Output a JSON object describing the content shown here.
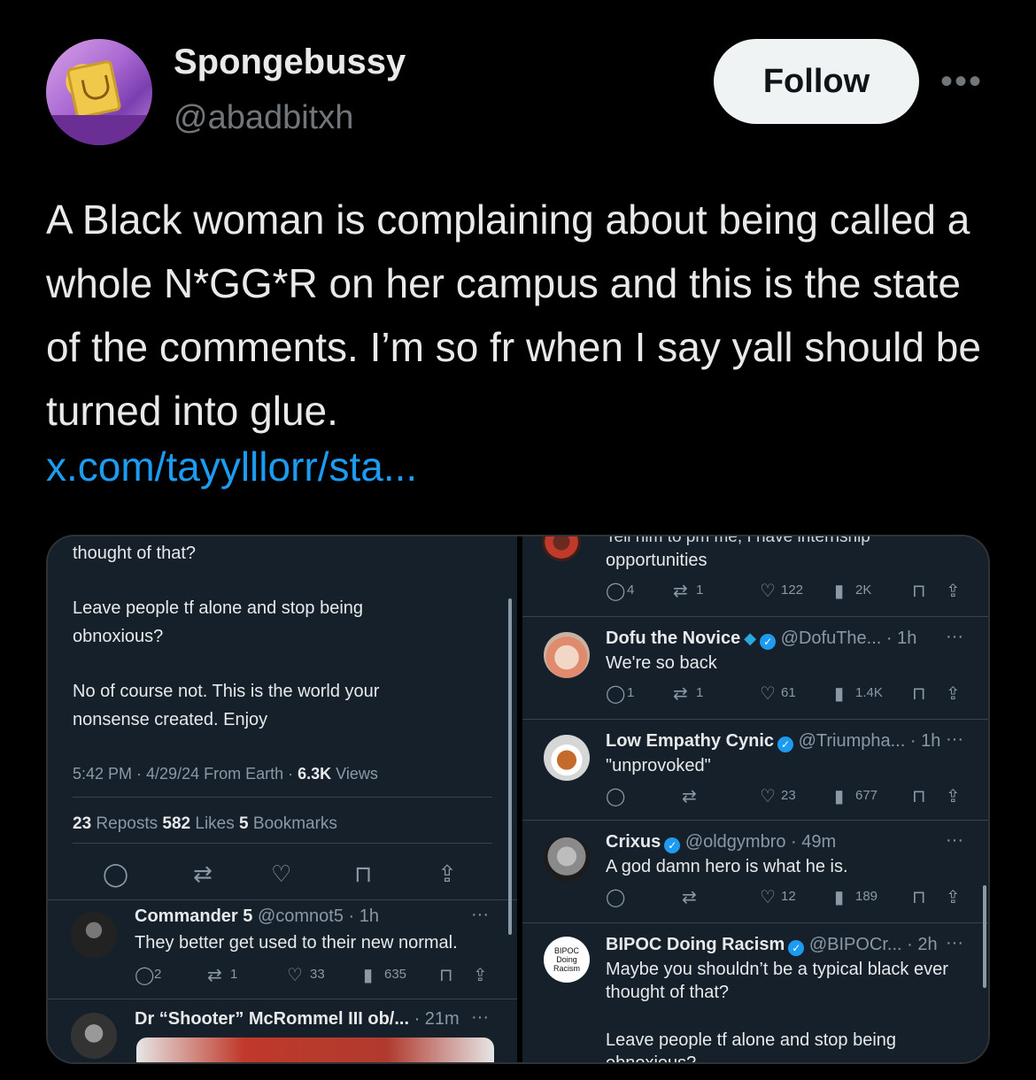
{
  "author": {
    "display_name": "Spongebussy",
    "handle": "@abadbitxh",
    "avatar_icon": "avatar-image"
  },
  "follow_label": "Follow",
  "more_label": "•••",
  "tweet": {
    "text": "A Black woman is complaining about being called a whole N*GG*R on her campus and this is the state of the comments. I’m so fr when I say yall should be turned into glue.",
    "link": "x.com/tayylllorr/sta..."
  },
  "left": {
    "line1": "thought of that?",
    "line2": "Leave people tf alone and stop being",
    "line3": "obnoxious?",
    "line4": "No of course not. This is the world your",
    "line5": "nonsense created. Enjoy",
    "meta_time": "5:42 PM · 4/29/24 From Earth · ",
    "meta_views_count": "6.3K",
    "meta_views_label": " Views",
    "reposts_count": "23",
    "reposts_label": "Reposts",
    "likes_count": "582",
    "likes_label": "Likes",
    "bookmarks_count": "5",
    "bookmarks_label": "Bookmarks",
    "reply1": {
      "name": "Commander 5",
      "handle_time": "@comnot5 · 1h",
      "text": "They better get used to their new normal.",
      "replies": "2",
      "reposts": "1",
      "likes": "33",
      "views": "635",
      "more": "···"
    },
    "reply2": {
      "name": "Dr “Shooter” McRommel III ob/...",
      "time": "· 21m",
      "more": "···"
    }
  },
  "right": {
    "top_text_cut": "Tell him to pm me, I have internship",
    "top_text": "opportunities",
    "top_stats": {
      "replies": "4",
      "reposts": "1",
      "likes": "122",
      "views": "2K"
    },
    "reply_dofu": {
      "name": "Dofu the Novice",
      "handle_time": "@DofuThe... · 1h",
      "text": "We're so back",
      "replies": "1",
      "reposts": "1",
      "likes": "61",
      "views": "1.4K",
      "more": "···"
    },
    "reply_cynic": {
      "name": "Low Empathy Cynic",
      "handle_time": "@Triumpha... · 1h",
      "text": "\"unprovoked\"",
      "likes": "23",
      "views": "677",
      "more": "···"
    },
    "reply_crixus": {
      "name": "Crixus",
      "handle_time": "@oldgymbro · 49m",
      "text": "A god damn hero is what he is.",
      "likes": "12",
      "views": "189",
      "more": "···"
    },
    "reply_bipoc": {
      "name": "BIPOC Doing Racism",
      "handle_time": "@BIPOCr... · 2h",
      "avatar_line1": "BIPOC",
      "avatar_line2": "Doing",
      "avatar_line3": "Racism",
      "text1": "Maybe you shouldn’t be a typical black ever",
      "text2": "thought of that?",
      "text3": "Leave people tf alone and stop being",
      "text4": "obnoxious?",
      "more": "···"
    }
  },
  "colors": {
    "background": "#000000",
    "card_bg": "#15202b",
    "link": "#1d9bf0",
    "follow_bg": "#eff3f4"
  }
}
